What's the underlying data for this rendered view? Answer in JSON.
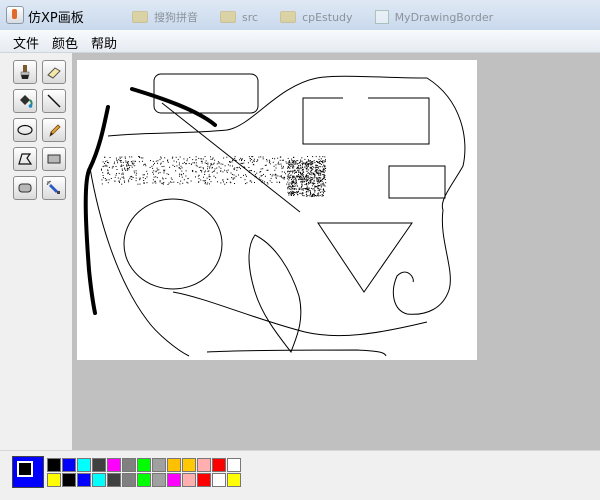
{
  "window": {
    "title": "仿XP画板"
  },
  "background_tabs": [
    "搜狗拼音",
    "src",
    "cpEstudy",
    "MyDrawingBorder"
  ],
  "menu": {
    "items": [
      "文件",
      "颜色",
      "帮助"
    ]
  },
  "tools": [
    {
      "name": "brush-icon",
      "tooltip": ""
    },
    {
      "name": "eraser-icon",
      "tooltip": ""
    },
    {
      "name": "fill-icon",
      "tooltip": ""
    },
    {
      "name": "line-icon",
      "tooltip": ""
    },
    {
      "name": "ellipse-icon",
      "tooltip": ""
    },
    {
      "name": "pencil-icon",
      "tooltip": ""
    },
    {
      "name": "polygon-icon",
      "tooltip": ""
    },
    {
      "name": "rectangle-icon",
      "tooltip": ""
    },
    {
      "name": "rounded-rect-icon",
      "tooltip": ""
    },
    {
      "name": "airbrush-icon",
      "tooltip": ""
    }
  ],
  "palette": {
    "current_foreground": "#000000",
    "current_background": "#0000ff",
    "colors": [
      "#000000",
      "#0000ff",
      "#00ffff",
      "#404040",
      "#ff00ff",
      "#808080",
      "#00ff00",
      "#a0a0a0",
      "#ffc000",
      "#ffc800",
      "#ffafaf",
      "#ff0000",
      "#ffffff",
      "#ffff00",
      "#000000",
      "#0000ff",
      "#00ffff",
      "#404040",
      "#808080",
      "#00ff00",
      "#a0a0a0",
      "#ff00ff",
      "#ffafaf",
      "#ff0000",
      "#ffffff",
      "#ffff00"
    ]
  },
  "colors": {
    "workspace": "#c0c0c0",
    "canvas": "#ffffff",
    "stroke": "#000000"
  }
}
